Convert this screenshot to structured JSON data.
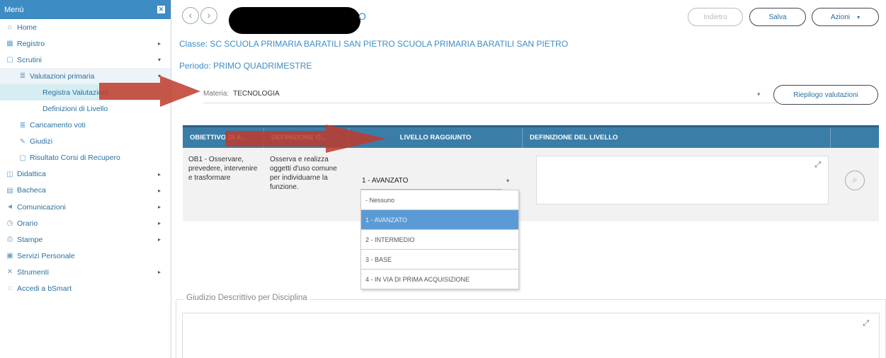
{
  "sidebar": {
    "header": "Menù",
    "items": [
      {
        "label": "Home",
        "icon": "home-icon",
        "glyph": "⌂",
        "arrow": ""
      },
      {
        "label": "Registro",
        "icon": "calendar-icon",
        "glyph": "▦",
        "arrow": "▸"
      },
      {
        "label": "Scrutini",
        "icon": "document-icon",
        "glyph": "▢",
        "arrow": "▾"
      },
      {
        "label": "Valutazioni primaria",
        "icon": "list-icon",
        "glyph": "≣",
        "arrow": "▾"
      },
      {
        "label": "Registra Valutazioni",
        "icon": "",
        "glyph": "",
        "arrow": ""
      },
      {
        "label": "Definizioni di Livello",
        "icon": "",
        "glyph": "",
        "arrow": ""
      },
      {
        "label": "Caricamento voti",
        "icon": "list-icon",
        "glyph": "≣",
        "arrow": ""
      },
      {
        "label": "Giudizi",
        "icon": "edit-icon",
        "glyph": "✎",
        "arrow": ""
      },
      {
        "label": "Risultato Corsi di Recupero",
        "icon": "document-icon",
        "glyph": "▢",
        "arrow": ""
      },
      {
        "label": "Didattica",
        "icon": "book-icon",
        "glyph": "◫",
        "arrow": "▸"
      },
      {
        "label": "Bacheca",
        "icon": "board-icon",
        "glyph": "▤",
        "arrow": "▸"
      },
      {
        "label": "Comunicazioni",
        "icon": "megaphone-icon",
        "glyph": "◄",
        "arrow": "▸"
      },
      {
        "label": "Orario",
        "icon": "clock-icon",
        "glyph": "◷",
        "arrow": "▸"
      },
      {
        "label": "Stampe",
        "icon": "print-icon",
        "glyph": "⎙",
        "arrow": "▸"
      },
      {
        "label": "Servizi Personale",
        "icon": "briefcase-icon",
        "glyph": "▣",
        "arrow": ""
      },
      {
        "label": "Strumenti",
        "icon": "tools-icon",
        "glyph": "✕",
        "arrow": "▸"
      },
      {
        "label": "Accedi a bSmart",
        "icon": "grid-icon",
        "glyph": "⁙",
        "arrow": ""
      }
    ]
  },
  "topbar": {
    "title_tail": "O",
    "back_label": "Indietro",
    "save_label": "Salva",
    "actions_label": "Azioni"
  },
  "info": {
    "classe": "Classe: SC SCUOLA PRIMARIA BARATILI SAN PIETRO SCUOLA PRIMARIA BARATILI SAN PIETRO",
    "periodo": "Periodo: PRIMO QUADRIMESTRE"
  },
  "materia": {
    "label": "Materia:",
    "value": "TECNOLOGIA",
    "riepilogo_label": "Riepilogo valutazioni"
  },
  "table": {
    "headers": [
      "OBIETTIVO DI A...",
      "DEFINIZIONE O...",
      "LIVELLO RAGGIUNTO",
      "DEFINIZIONE DEL LIVELLO",
      ""
    ],
    "row": {
      "obiettivo": "OB1 - Osservare, prevedere, intervenire e trasformare",
      "definizione": "Osserva e realizza oggetti d'uso comune per individuarne la funzione.",
      "livello": "1 - AVANZATO"
    }
  },
  "dropdown": {
    "options": [
      "- Nessuno",
      "1 - AVANZATO",
      "2 - INTERMEDIO",
      "3 - BASE",
      "4 - IN VIA DI PRIMA ACQUISIZIONE"
    ],
    "selected_index": 1
  },
  "giudizio": {
    "legend": "Giudizio Descrittivo per Disciplina"
  },
  "colors": {
    "accent": "#3e8cc4",
    "table_header": "#3a7ea8",
    "arrow_red": "#c0392b",
    "selected_option": "#5b9bd5"
  }
}
